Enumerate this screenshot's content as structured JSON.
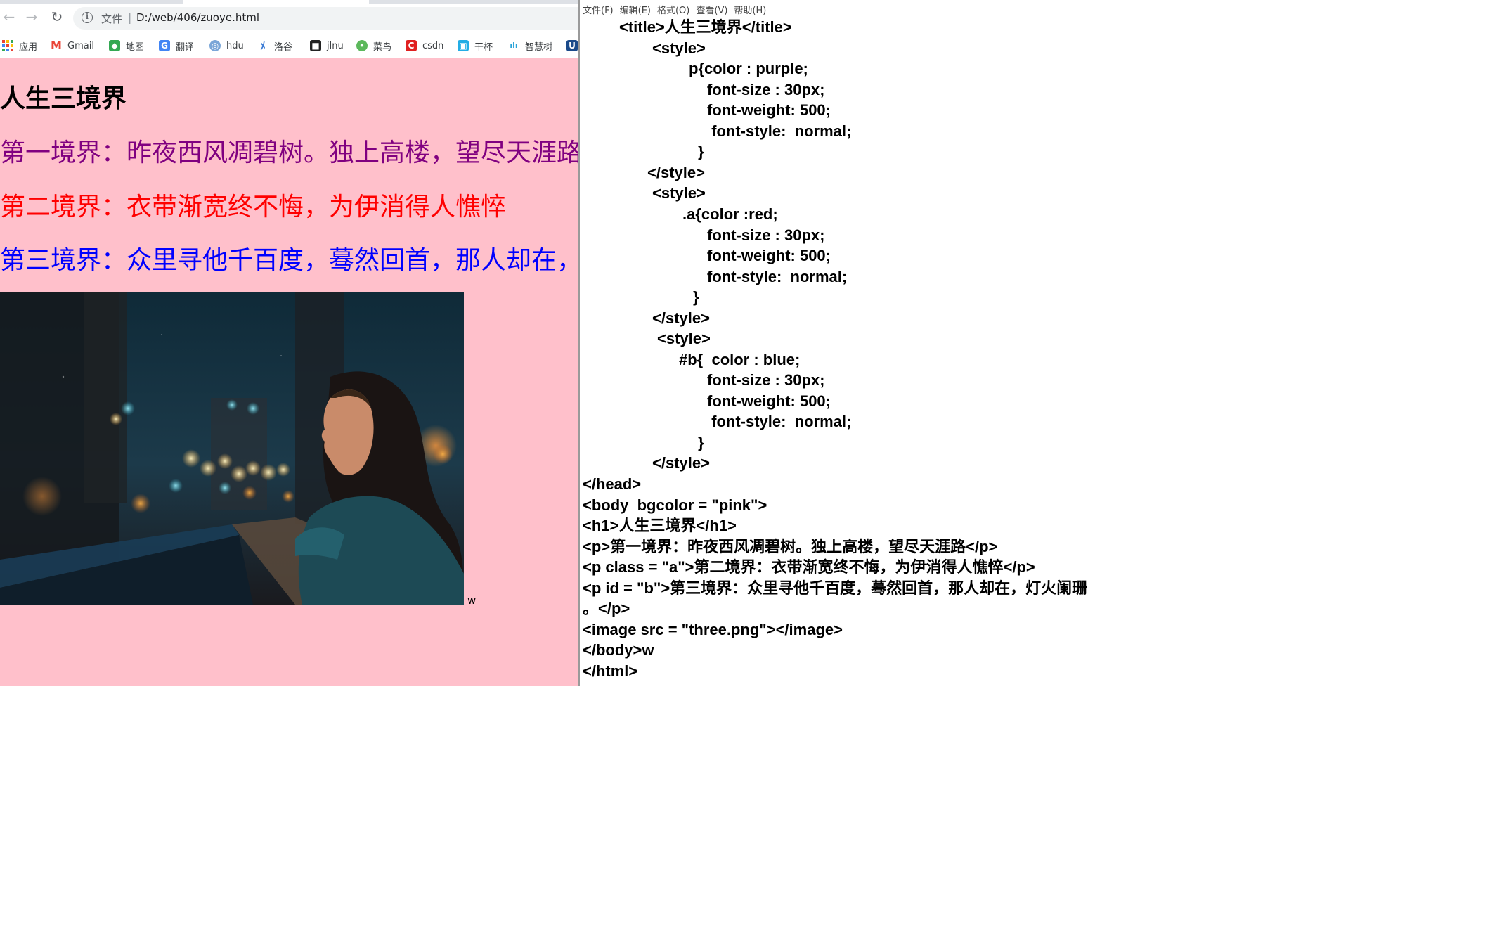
{
  "browser": {
    "address": {
      "scheme": "文件",
      "separator": "|",
      "url": "D:/web/406/zuoye.html"
    },
    "bookmarks": [
      {
        "label": "应用",
        "icon": "apps-grid-icon"
      },
      {
        "label": "Gmail",
        "icon": "gmail-icon"
      },
      {
        "label": "地图",
        "icon": "maps-icon"
      },
      {
        "label": "翻译",
        "icon": "translate-icon"
      },
      {
        "label": "hdu",
        "icon": "hdu-icon"
      },
      {
        "label": "洛谷",
        "icon": "luogu-icon"
      },
      {
        "label": "jlnu",
        "icon": "jlnu-icon"
      },
      {
        "label": "菜鸟",
        "icon": "runoob-icon"
      },
      {
        "label": "csdn",
        "icon": "csdn-icon"
      },
      {
        "label": "干杯",
        "icon": "bilibili-icon"
      },
      {
        "label": "智慧树",
        "icon": "zhihuishu-icon"
      },
      {
        "label": "U",
        "icon": "u-icon"
      }
    ],
    "page": {
      "heading": "人生三境界",
      "p1": "第一境界：昨夜西风凋碧树。独上高楼，望尽天涯路",
      "p2": "第二境界：衣带渐宽终不悔，为伊消得人憔悴",
      "p3": "第三境界：众里寻他千百度，蓦然回首，那人却在，灯火阑珊",
      "trailing_text": "w",
      "background": "pink"
    }
  },
  "notepad": {
    "menu": [
      "文件(F)",
      "编辑(E)",
      "格式(O)",
      "查看(V)",
      "帮助(H)"
    ],
    "lines": [
      "<title>人生三境界</title>",
      "<style>",
      "p{color : purple;",
      "font-size : 30px;",
      "font-weight: 500;",
      " font-style:  normal;",
      "}",
      "</style>",
      "<style>",
      ".a{color :red;",
      "font-size : 30px;",
      "font-weight: 500;",
      "font-style:  normal;",
      "}",
      "</style>",
      "<style>",
      "#b{  color : blue;",
      "font-size : 30px;",
      "font-weight: 500;",
      " font-style:  normal;",
      "}",
      "</style>",
      "</head>",
      "<body  bgcolor = \"pink\">",
      "<h1>人生三境界</h1>",
      "<p>第一境界：昨夜西风凋碧树。独上高楼，望尽天涯路</p>",
      "<p class = \"a\">第二境界：衣带渐宽终不悔，为伊消得人憔悴</p>",
      "<p id = \"b\">第三境界：众里寻他千百度，蓦然回首，那人却在，灯火阑珊",
      "。</p>",
      "<image src = \"three.png\"></image>",
      "</body>w",
      "</html>"
    ]
  },
  "colors": {
    "purple": "purple",
    "red": "red",
    "blue": "blue",
    "pink": "pink"
  }
}
